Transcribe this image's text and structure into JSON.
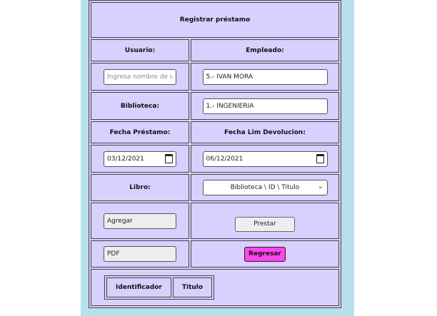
{
  "form": {
    "title": "Registrar préstamo",
    "usuario_label": "Usuario:",
    "empleado_label": "Empleado:",
    "usuario_placeholder": "Ingresa nombre de usuario",
    "empleado_value": "5.- IVAN MORA",
    "biblioteca_label": "Biblioteca:",
    "biblioteca_value": "1.- INGENIERIA",
    "fecha_prestamo_label": "Fecha Préstamo:",
    "fecha_devolucion_label": "Fecha Lim Devolucion:",
    "fecha_prestamo_value": "03/12/2021",
    "fecha_devolucion_value": "06/12/2021",
    "libro_label": "Libro:",
    "libro_select": "Biblioteca \\ ID \\ Titulo",
    "agregar_value": "Agregar",
    "prestar_label": "Prestar",
    "pdf_value": "PDF",
    "regresar_label": "Regresar"
  },
  "table": {
    "columns": [
      "Identificador",
      "Titulo"
    ]
  },
  "colors": {
    "panel_bg": "#b8e0ec",
    "form_bg": "#d8d0ff",
    "regresar_bg": "#ff44ee"
  },
  "icons": {
    "calendar": "calendar-icon",
    "select": "chevron-down-icon"
  }
}
